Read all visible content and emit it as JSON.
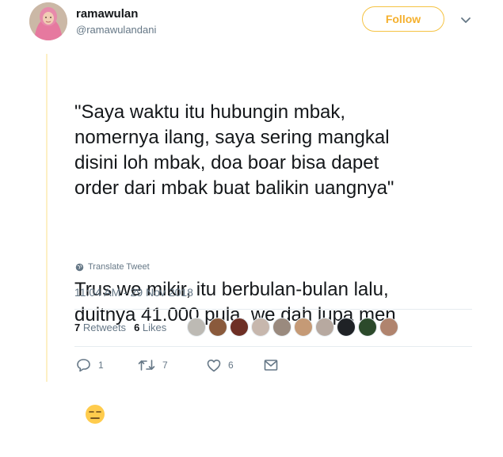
{
  "user": {
    "display_name": "ramawulan",
    "handle": "@ramawulandani"
  },
  "follow_button": {
    "label": "Follow"
  },
  "tweet": {
    "paragraphs": [
      "\"Saya waktu itu hubungin mbak,\nnomernya ilang, saya sering mangkal\ndisini loh mbak, doa boar bisa dapet\norder dari mbak buat balikin uangnya\"",
      "Trus we mikir, itu berbulan-bulan lalu,\nduitnya 41.000 pula, we dah lupa men"
    ],
    "emoji_icon": "expressionless-face-emoji",
    "translate_label": "Translate Tweet",
    "timestamp": "11:04 AM - 29 Nov 2018"
  },
  "stats": {
    "retweets_count": "7",
    "retweets_label": "Retweets",
    "likes_count": "6",
    "likes_label": "Likes",
    "liker_avatar_colors": [
      "#bdbab4",
      "#8a5a3c",
      "#6e2f25",
      "#c7b7ad",
      "#9a8a7e",
      "#c59a76",
      "#b7a9a0",
      "#1f2226",
      "#2c4a2b",
      "#b0846e"
    ]
  },
  "actions": {
    "reply_count": "1",
    "retweet_count": "7",
    "like_count": "6"
  },
  "colors": {
    "accent": "#f5b02d",
    "thread_line": "#fdf0c5",
    "muted": "#657786"
  }
}
